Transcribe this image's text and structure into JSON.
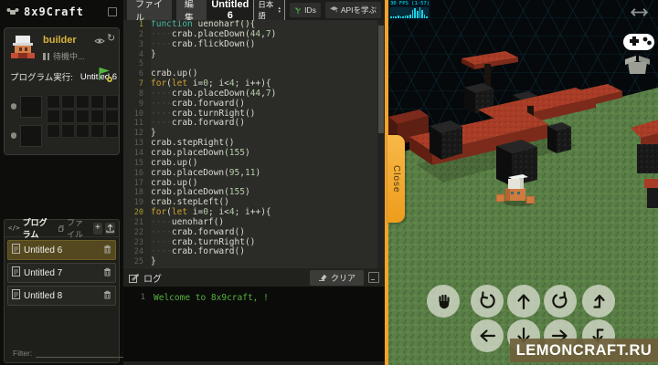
{
  "app": {
    "logo_text": "8x9Craft"
  },
  "sidebar": {
    "robot": {
      "name": "builder",
      "status_text": "待機中...",
      "run_label": "プログラム実行:",
      "run_program": "Untitled 6"
    },
    "panel_tabs": {
      "programs": "プログラム",
      "files": "ファイル",
      "code_glyph": "</>"
    },
    "add_button": "+",
    "programs": [
      {
        "name": "Untitled 6",
        "selected": true
      },
      {
        "name": "Untitled 7",
        "selected": false
      },
      {
        "name": "Untitled 8",
        "selected": false
      }
    ],
    "filter_label": "Filter:",
    "filter_value": "",
    "filter_clear": "×"
  },
  "editor": {
    "menu": {
      "file": "ファイル",
      "edit": "編集"
    },
    "title": "Untitled 6",
    "language_select": "日本語",
    "ids_button": "IDs",
    "api_button": "APIを学ぶ",
    "code_lines": [
      "function uenoharf(){",
      "    crab.placeDown(44,7)",
      "    crab.flickDown()",
      "}",
      "",
      "crab.up()",
      "for(let i=0; i<4; i++){",
      "    crab.placeDown(44,7)",
      "    crab.forward()",
      "    crab.turnRight()",
      "    crab.forward()",
      "}",
      "crab.stepRight()",
      "crab.placeDown(155)",
      "crab.up()",
      "crab.placeDown(95,11)",
      "crab.up()",
      "crab.placeDown(155)",
      "crab.stepLeft()",
      "for(let i=0; i<4; i++){",
      "    uenoharf()",
      "    crab.forward()",
      "    crab.turnRight()",
      "    crab.forward()",
      "}"
    ],
    "log": {
      "title": "ログ",
      "clear_button": "クリア",
      "lines": [
        {
          "num": 1,
          "text": "Welcome to 8x9craft, !"
        }
      ]
    }
  },
  "game": {
    "fps_text": "30 FPS (1-57)",
    "fps_bars": [
      2,
      2,
      2,
      3,
      2,
      2,
      3,
      3,
      4,
      9,
      11,
      8,
      12,
      9,
      4,
      2
    ],
    "close_tab": "Close",
    "watermark": "LEMONCRAFT.RU",
    "controls": {
      "row1": [
        "hand",
        "rotate-ccw",
        "up",
        "rotate-cw",
        "step-up"
      ],
      "row2": [
        "left",
        "down",
        "right",
        "step-down"
      ]
    },
    "side_icons": [
      "resize-horizontal-icon",
      "gamepad-icon",
      "armor-box-icon"
    ]
  },
  "colors": {
    "accent_orange": "#f2a32b",
    "log_green": "#55b33c",
    "name_gold": "#d9b43a",
    "fps_cyan": "#19d3e8"
  }
}
